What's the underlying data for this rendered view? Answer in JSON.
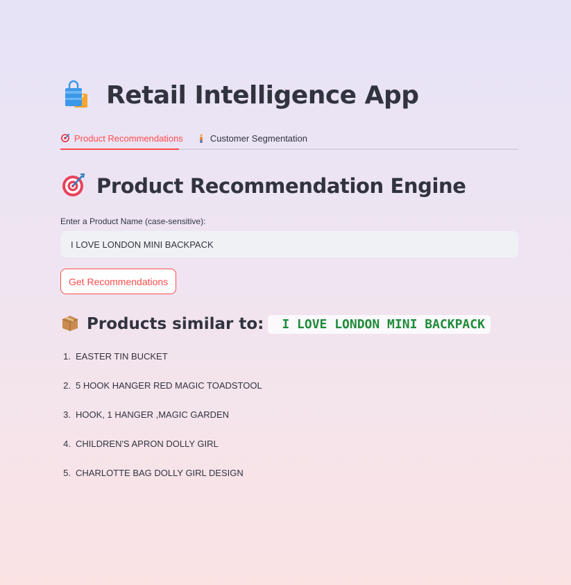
{
  "app": {
    "title": "Retail Intelligence App",
    "icon": "shopping-bags-icon"
  },
  "tabs": [
    {
      "label": "Product Recommendations",
      "icon": "target-icon",
      "active": true
    },
    {
      "label": "Customer Segmentation",
      "icon": "person-icon",
      "active": false
    }
  ],
  "section": {
    "title": "Product Recommendation Engine",
    "icon": "target-icon"
  },
  "input": {
    "label": "Enter a Product Name (case-sensitive):",
    "value": "I LOVE LONDON MINI BACKPACK"
  },
  "button": {
    "label": "Get Recommendations"
  },
  "results": {
    "heading": "Products similar to:",
    "icon": "package-icon",
    "query": "I LOVE LONDON MINI BACKPACK",
    "items": [
      {
        "num": "1.",
        "name": "EASTER TIN BUCKET"
      },
      {
        "num": "2.",
        "name": "5 HOOK HANGER RED MAGIC TOADSTOOL"
      },
      {
        "num": "3.",
        "name": "HOOK, 1 HANGER ,MAGIC GARDEN"
      },
      {
        "num": "4.",
        "name": "CHILDREN'S APRON DOLLY GIRL"
      },
      {
        "num": "5.",
        "name": "CHARLOTTE BAG DOLLY GIRL DESIGN"
      }
    ]
  },
  "colors": {
    "accent": "#ff4b4b",
    "code_green": "#1f8b39",
    "text": "#31333f"
  }
}
